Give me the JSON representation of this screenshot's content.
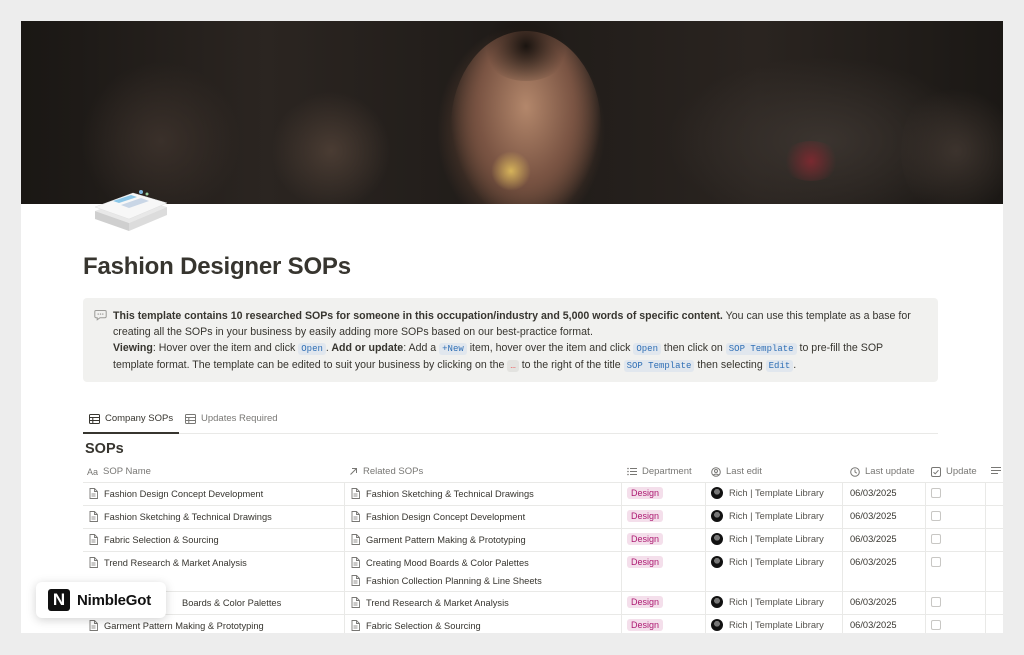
{
  "page": {
    "title": "Fashion Designer SOPs"
  },
  "callout": {
    "p1_bold": "This template contains 10 researched SOPs for someone in this occupation/industry and 5,000 words of specific content.",
    "p1_rest": " You can use this template as a base for creating all the SOPs in your business by easily adding more SOPs based on our best-practice format.",
    "viewing_label": "Viewing",
    "viewing_text": ": Hover over the item and click ",
    "open_code": "Open",
    "period": ".",
    "add_label": " Add or update",
    "add_text": ": Add a ",
    "new_code": "+New",
    "add_text2": " item, hover over the item and click ",
    "then_click": " then click on ",
    "sop_template_code": "SOP Template",
    "prefill_text": " to pre-fill the SOP template format. The template can be edited to suit your business by clicking on the ",
    "dots_code": "…",
    "right_text": " to the right of the title ",
    "then_selecting": " then selecting ",
    "edit_code": "Edit",
    "end": "."
  },
  "tabs": [
    {
      "label": "Company SOPs",
      "active": true
    },
    {
      "label": "Updates Required",
      "active": false
    }
  ],
  "database": {
    "title": "SOPs",
    "columns": {
      "name": {
        "icon": "Aa",
        "label": "SOP Name"
      },
      "related": {
        "label": "Related SOPs"
      },
      "department": {
        "label": "Department"
      },
      "last_edit": {
        "label": "Last edit"
      },
      "last_update": {
        "label": "Last update"
      },
      "update": {
        "label": "Update"
      }
    },
    "rows": [
      {
        "name": "Fashion Design Concept Development",
        "related": [
          "Fashion Sketching & Technical Drawings"
        ],
        "department": "Design",
        "last_edit": "Rich | Template Library",
        "last_update": "06/03/2025"
      },
      {
        "name": "Fashion Sketching & Technical Drawings",
        "related": [
          "Fashion Design Concept Development"
        ],
        "department": "Design",
        "last_edit": "Rich | Template Library",
        "last_update": "06/03/2025"
      },
      {
        "name": "Fabric Selection & Sourcing",
        "related": [
          "Garment Pattern Making & Prototyping"
        ],
        "department": "Design",
        "last_edit": "Rich | Template Library",
        "last_update": "06/03/2025"
      },
      {
        "name": "Trend Research & Market Analysis",
        "related": [
          "Creating Mood Boards & Color Palettes",
          "Fashion Collection Planning & Line Sheets"
        ],
        "department": "Design",
        "last_edit": "Rich | Template Library",
        "last_update": "06/03/2025"
      },
      {
        "name": "Boards & Color Palettes",
        "related": [
          "Trend Research & Market Analysis"
        ],
        "department": "Design",
        "last_edit": "Rich | Template Library",
        "last_update": "06/03/2025"
      },
      {
        "name": "Garment Pattern Making & Prototyping",
        "related": [
          "Fabric Selection & Sourcing"
        ],
        "department": "Design",
        "last_edit": "Rich | Template Library",
        "last_update": "06/03/2025"
      }
    ]
  },
  "brand": {
    "logo_letter": "N",
    "name": "NimbleGot"
  },
  "colors": {
    "tag_bg": "#f4dfeb",
    "tag_text": "#ad1a72",
    "code_red": "#eb5757",
    "code_blue": "#2f6fb5"
  }
}
